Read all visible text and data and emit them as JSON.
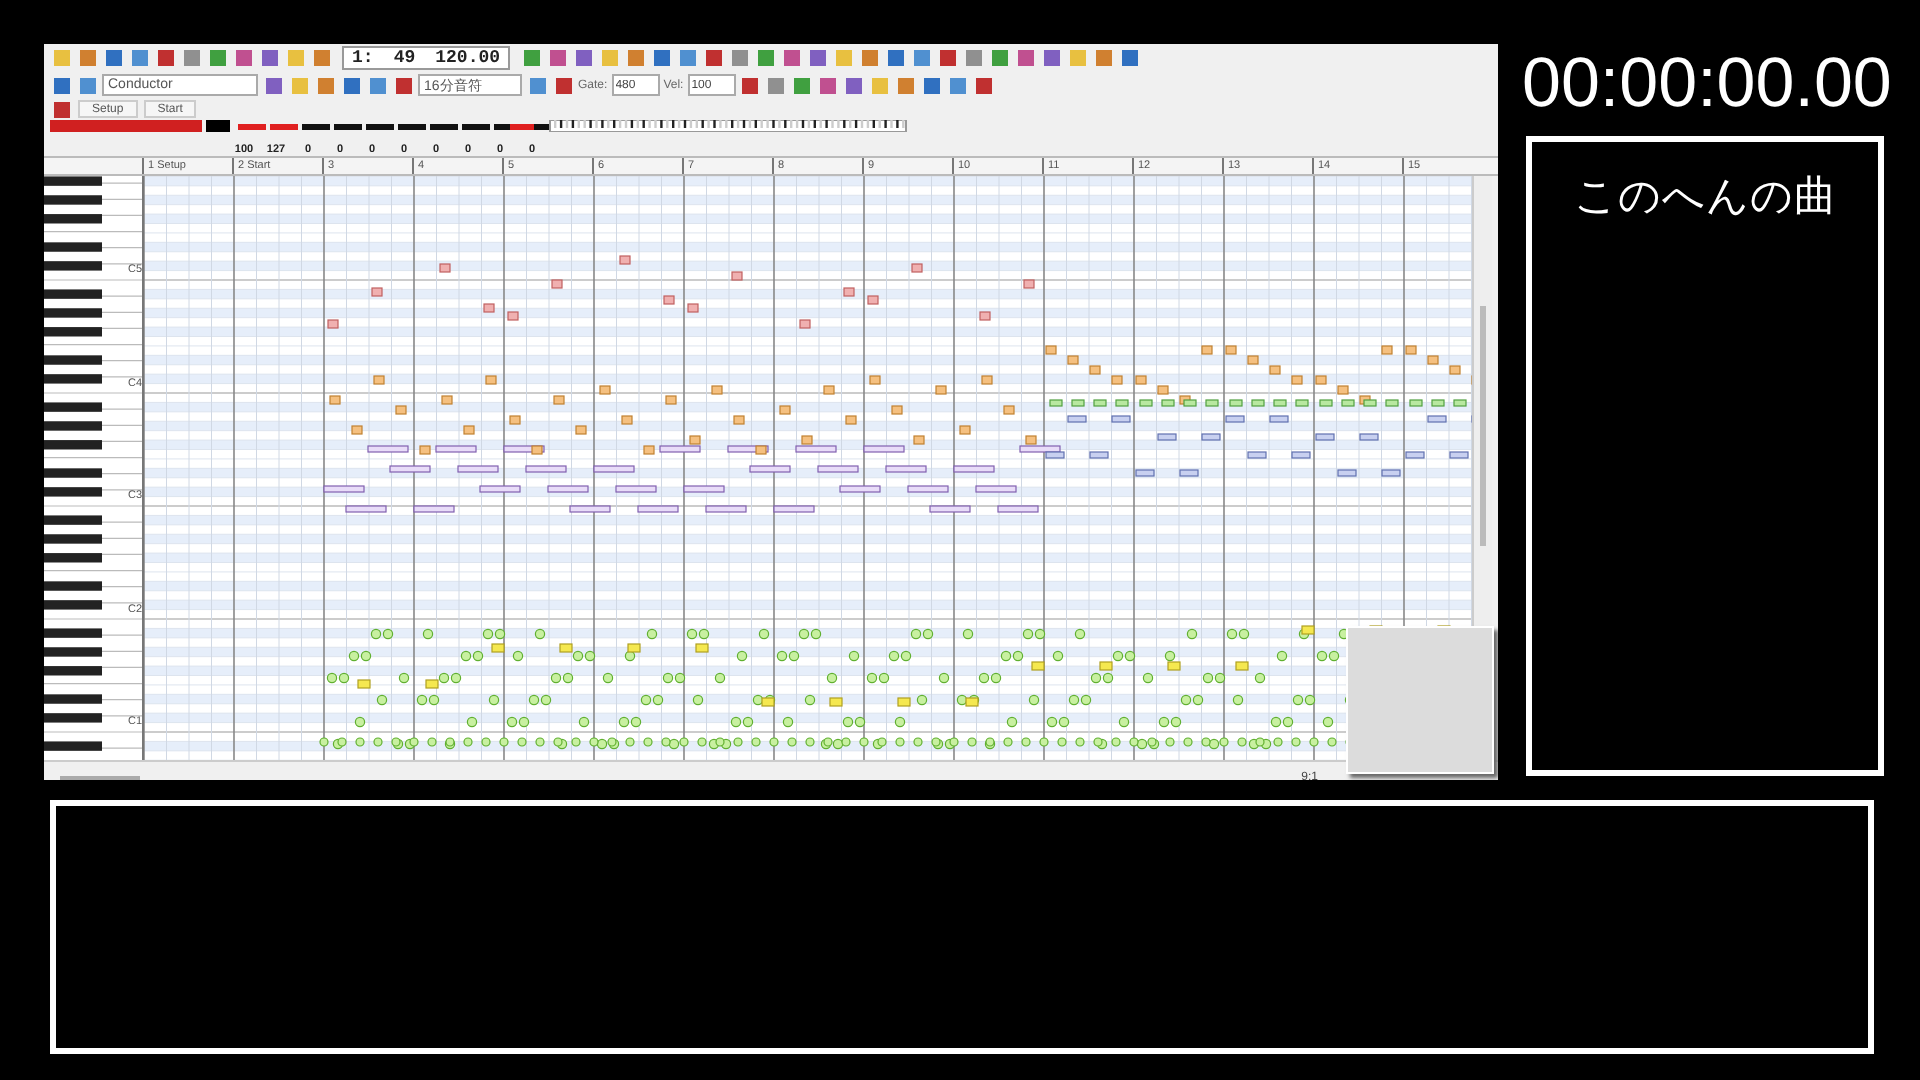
{
  "sequencer": {
    "counter": {
      "measure": "1:",
      "tick": "49",
      "tempo": "120.00"
    },
    "track_select": "Conductor",
    "note_length": "16分音符",
    "gate": {
      "label": "Gate:",
      "value": "480"
    },
    "velocity": {
      "label": "Vel:",
      "value": "100"
    },
    "tabs": [
      {
        "label": "Setup",
        "selected": false
      },
      {
        "label": "Start",
        "selected": false
      }
    ],
    "mixer_readings": [
      "100",
      "127",
      "0",
      "0",
      "0",
      "0",
      "0",
      "0",
      "0",
      "0"
    ],
    "ruler": [
      "1 Setup",
      "2 Start",
      "3",
      "4",
      "5",
      "6",
      "7",
      "8",
      "9",
      "10",
      "11",
      "12",
      "13",
      "14",
      "15"
    ],
    "octaves": [
      "C5",
      "C4",
      "C3",
      "C2",
      "C1"
    ],
    "position": "9:1"
  },
  "timer": "00:00:00.00",
  "song_title": "このへんの曲"
}
